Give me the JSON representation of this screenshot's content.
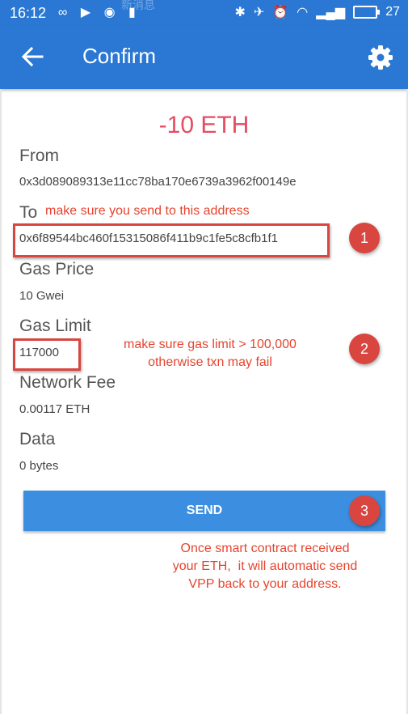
{
  "status_bar": {
    "time": "16:12",
    "battery": "27",
    "ghost_text": "新消息"
  },
  "header": {
    "title": "Confirm"
  },
  "amount": "-10 ETH",
  "fields": {
    "from": {
      "label": "From",
      "value": "0x3d089089313e11cc78ba170e6739a3962f00149e"
    },
    "to": {
      "label": "To",
      "value": "0x6f89544bc460f15315086f411b9c1fe5c8cfb1f1"
    },
    "gas_price": {
      "label": "Gas Price",
      "value": "10 Gwei"
    },
    "gas_limit": {
      "label": "Gas Limit",
      "value": "117000"
    },
    "network_fee": {
      "label": "Network Fee",
      "value": "0.00117 ETH"
    },
    "data": {
      "label": "Data",
      "value": "0 bytes"
    }
  },
  "send_label": "SEND",
  "annotations": {
    "to_note": "make sure you send to this address",
    "gas_note_line1": "make sure gas limit > 100,000",
    "gas_note_line2": "otherwise txn may fail",
    "send_note_line1": "Once smart contract received",
    "send_note_line2": "your ETH,  it will automatic send",
    "send_note_line3": "VPP back to your address.",
    "badges": [
      "1",
      "2",
      "3"
    ]
  },
  "colors": {
    "primary": "#2a78d3",
    "button": "#3c8fe0",
    "amount": "#e44c63",
    "annotation": "#d8463f"
  },
  "icons": {
    "back": "arrow-back-icon",
    "settings": "gear-icon"
  }
}
